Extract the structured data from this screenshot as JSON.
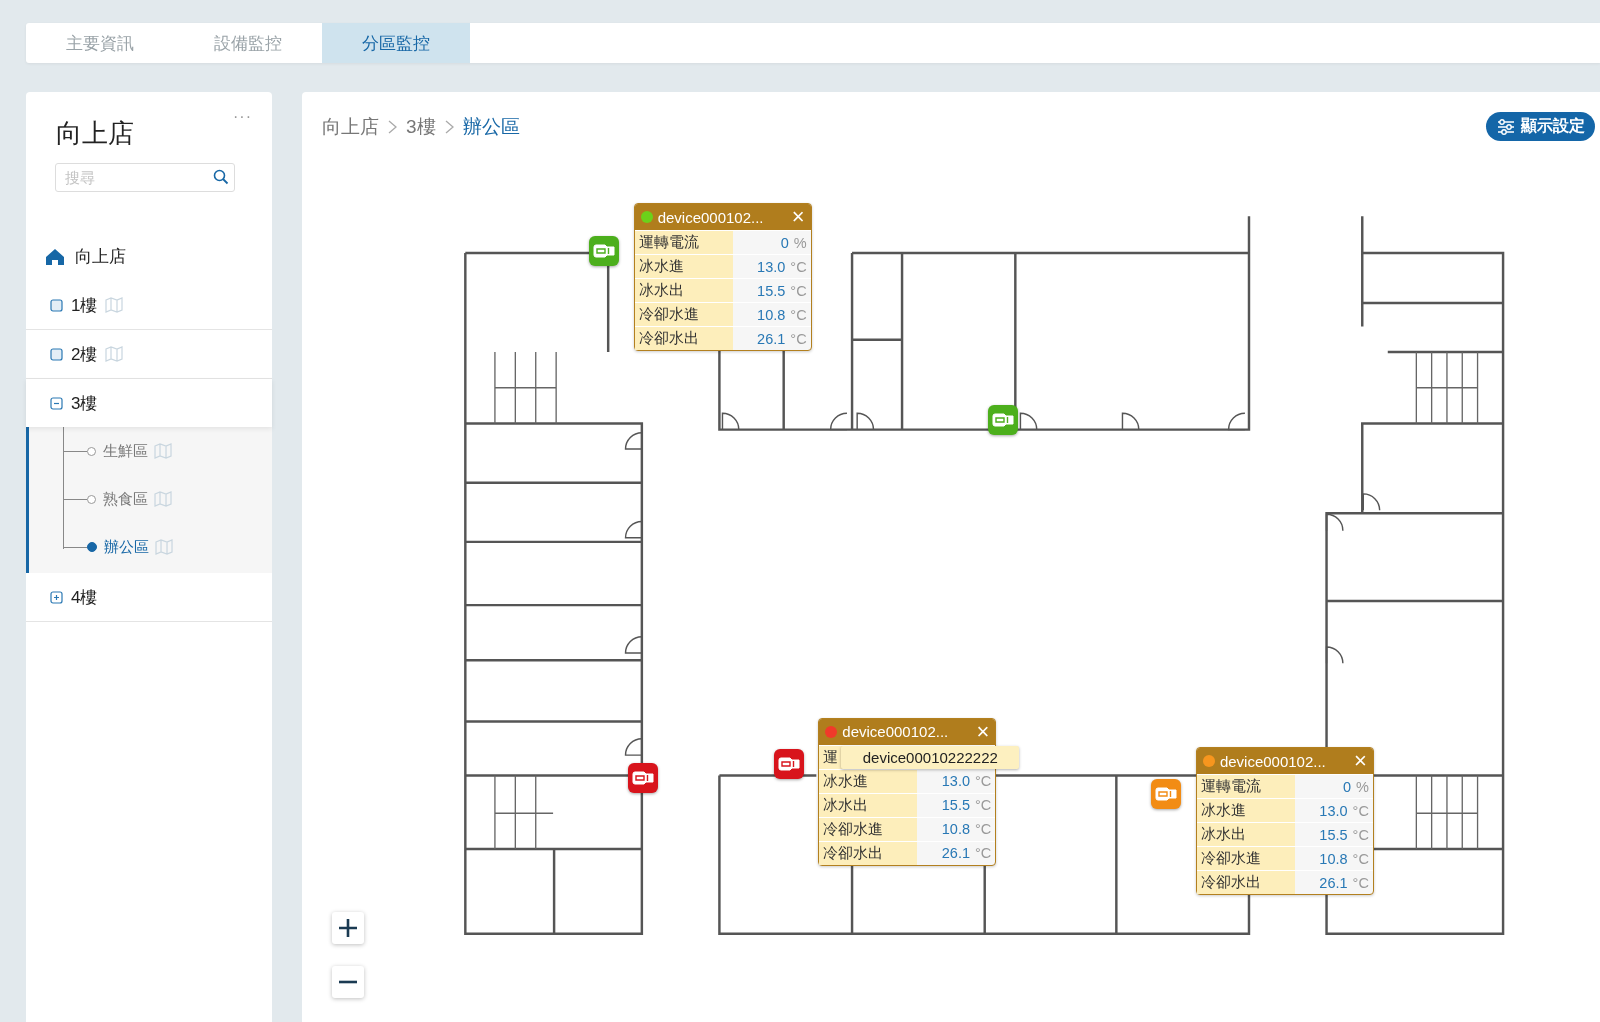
{
  "tabs": [
    {
      "label": "主要資訊",
      "selected": false
    },
    {
      "label": "設備監控",
      "selected": false
    },
    {
      "label": "分區監控",
      "selected": true
    }
  ],
  "sidebar": {
    "title": "向上店",
    "more": "···",
    "search": {
      "placeholder": "搜尋"
    },
    "tree": {
      "label": "向上店",
      "children": [
        {
          "label": "1樓",
          "kind": "leaf",
          "selected": false
        },
        {
          "label": "2樓",
          "kind": "leaf",
          "selected": false
        },
        {
          "label": "3樓",
          "kind": "group",
          "expanded": true,
          "selected": true,
          "children": [
            {
              "label": "生鮮區",
              "selected": false
            },
            {
              "label": "熟食區",
              "selected": false
            },
            {
              "label": "辦公區",
              "selected": true
            }
          ]
        },
        {
          "label": "4樓",
          "kind": "group",
          "expanded": false,
          "selected": false
        }
      ]
    }
  },
  "breadcrumb": [
    "向上店",
    "3樓",
    "辦公區"
  ],
  "display_settings_button": "顯示設定",
  "map": {
    "kind": "picture",
    "markers": [
      {
        "color": "#4caf1c"
      },
      {
        "color": "#4caf1c"
      },
      {
        "color": "#d8141c"
      },
      {
        "color": "#d8141c"
      },
      {
        "color": "#f28c14"
      }
    ],
    "popups": [
      {
        "title": "device000102...",
        "color": "#6cd11a",
        "close": "×",
        "rows": [
          {
            "label": "運轉電流",
            "value": "0",
            "unit": "%"
          },
          {
            "label": "冰水進",
            "value": "13.0",
            "unit": "°C"
          },
          {
            "label": "冰水出",
            "value": "15.5",
            "unit": "°C"
          },
          {
            "label": "冷卻水進",
            "value": "10.8",
            "unit": "°C"
          },
          {
            "label": "冷卻水出",
            "value": "26.1",
            "unit": "°C"
          }
        ]
      },
      {
        "title": "device000102...",
        "color": "#f03a2a",
        "close": "×",
        "rows": [
          {
            "label": "運"
          },
          {
            "label": "冰水進",
            "value": "13.0",
            "unit": "°C"
          },
          {
            "label": "冰水出",
            "value": "15.5",
            "unit": "°C"
          },
          {
            "label": "冷卻水進",
            "value": "10.8",
            "unit": "°C"
          },
          {
            "label": "冷卻水出",
            "value": "26.1",
            "unit": "°C"
          }
        ]
      },
      {
        "title": "device000102...",
        "color": "#f7961e",
        "close": "×",
        "rows": [
          {
            "label": "運轉電流",
            "value": "0",
            "unit": "%"
          },
          {
            "label": "冰水進",
            "value": "13.0",
            "unit": "°C"
          },
          {
            "label": "冰水出",
            "value": "15.5",
            "unit": "°C"
          },
          {
            "label": "冷卻水進",
            "value": "10.8",
            "unit": "°C"
          },
          {
            "label": "冷卻水出",
            "value": "26.1",
            "unit": "°C"
          }
        ]
      }
    ],
    "tooltip": "device00010222222"
  }
}
